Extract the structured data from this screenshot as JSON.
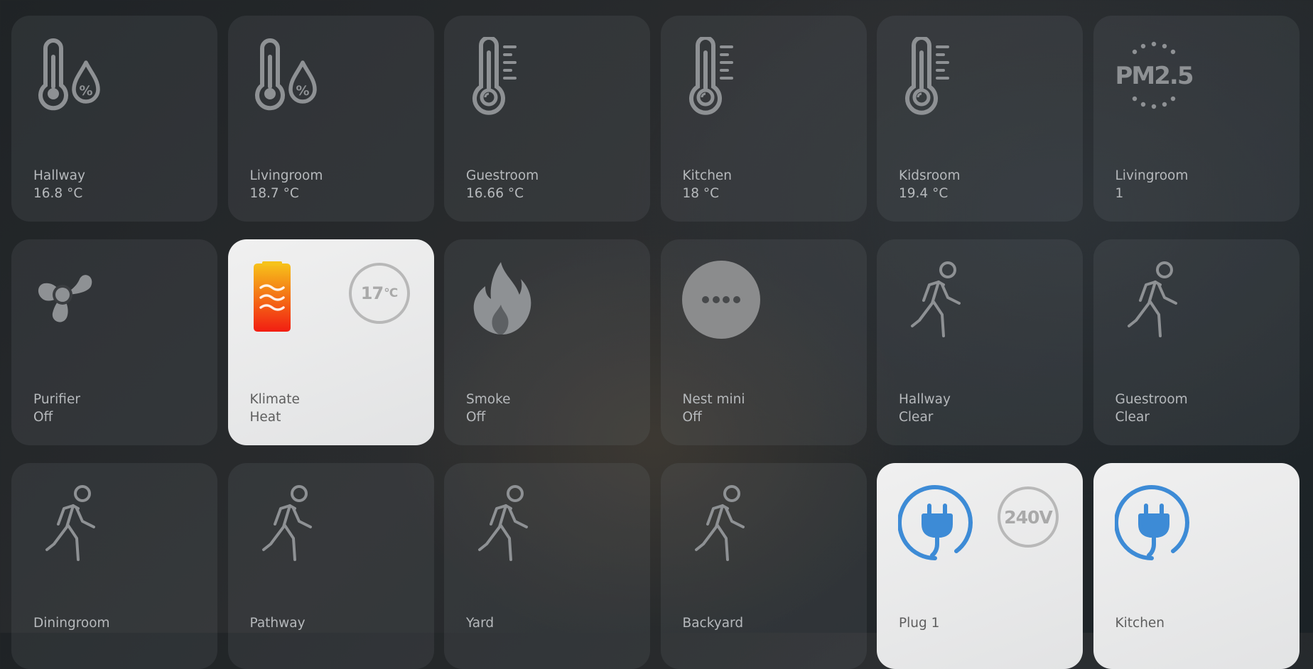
{
  "tiles": [
    {
      "name": "Hallway",
      "state": "16.8 °C",
      "icon": "thermometer-humidity-icon"
    },
    {
      "name": "Livingroom",
      "state": "18.7 °C",
      "icon": "thermometer-humidity-icon"
    },
    {
      "name": "Guestroom",
      "state": "16.66 °C",
      "icon": "thermometer-icon"
    },
    {
      "name": "Kitchen",
      "state": "18 °C",
      "icon": "thermometer-icon"
    },
    {
      "name": "Kidsroom",
      "state": "19.4 °C",
      "icon": "thermometer-icon"
    },
    {
      "name": "Livingroom",
      "state": "1",
      "icon": "pm25-icon",
      "icon_text": "PM2.5"
    },
    {
      "name": "Purifier",
      "state": "Off",
      "icon": "fan-icon"
    },
    {
      "name": "Klimate",
      "state": "Heat",
      "icon": "heater-icon",
      "badge_value": "17",
      "badge_unit": "°C"
    },
    {
      "name": "Smoke",
      "state": "Off",
      "icon": "flame-icon"
    },
    {
      "name": "Nest mini",
      "state": "Off",
      "icon": "speaker-dots-icon"
    },
    {
      "name": "Hallway",
      "state": "Clear",
      "icon": "walking-person-icon"
    },
    {
      "name": "Guestroom",
      "state": "Clear",
      "icon": "walking-person-icon"
    },
    {
      "name": "Diningroom",
      "state": "",
      "icon": "walking-person-icon"
    },
    {
      "name": "Pathway",
      "state": "",
      "icon": "walking-person-icon"
    },
    {
      "name": "Yard",
      "state": "",
      "icon": "walking-person-icon"
    },
    {
      "name": "Backyard",
      "state": "",
      "icon": "walking-person-icon"
    },
    {
      "name": "Plug 1",
      "state": "",
      "icon": "power-plug-icon",
      "badge_value": "240V"
    },
    {
      "name": "Kitchen",
      "state": "",
      "icon": "power-plug-icon"
    }
  ],
  "colors": {
    "icon_gray": "#8e9194",
    "plug_blue": "#3d8bd6",
    "heater_top": "#f6c21a",
    "heater_bottom": "#f21d12",
    "tile_on": "#e6e7e8"
  }
}
